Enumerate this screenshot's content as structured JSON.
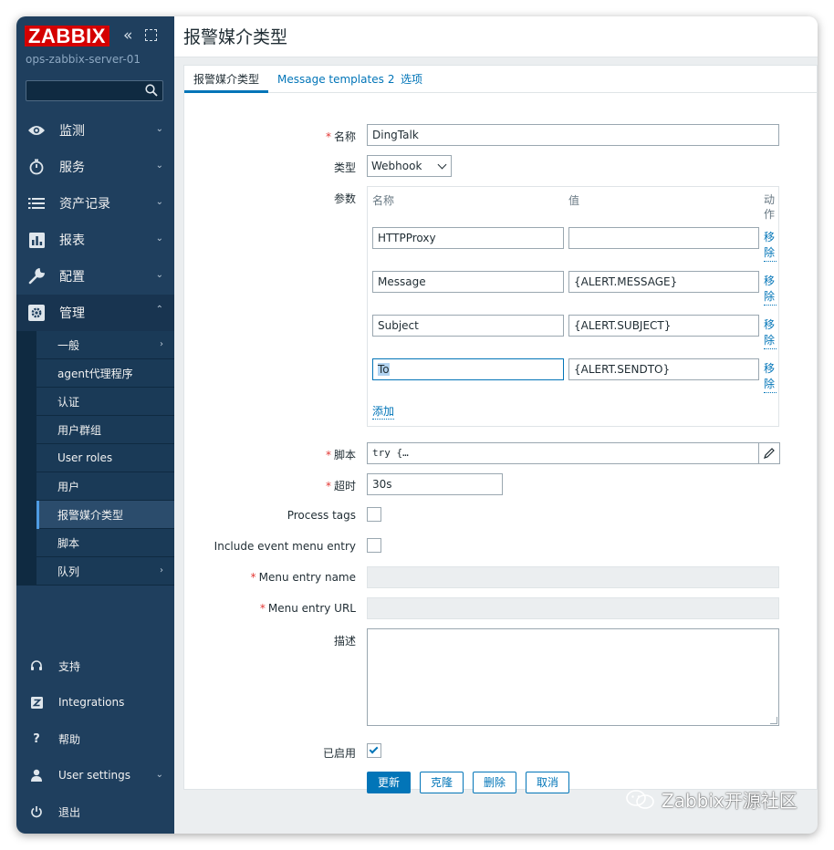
{
  "sidebar": {
    "logo": "ZABBIX",
    "collapse_glyph": "«",
    "server_name": "ops-zabbix-server-01",
    "search_placeholder": "",
    "menu": [
      {
        "label": "监测",
        "icon": "eye-icon"
      },
      {
        "label": "服务",
        "icon": "stopwatch-icon"
      },
      {
        "label": "资产记录",
        "icon": "list-icon"
      },
      {
        "label": "报表",
        "icon": "bar-chart-icon"
      },
      {
        "label": "配置",
        "icon": "wrench-icon"
      },
      {
        "label": "管理",
        "icon": "gear-icon"
      }
    ],
    "submenu": [
      {
        "label": "一般"
      },
      {
        "label": "agent代理程序"
      },
      {
        "label": "认证"
      },
      {
        "label": "用户群组"
      },
      {
        "label": "User roles"
      },
      {
        "label": "用户"
      },
      {
        "label": "报警媒介类型"
      },
      {
        "label": "脚本"
      },
      {
        "label": "队列"
      }
    ],
    "bottom": [
      {
        "label": "支持",
        "icon": "headset-icon"
      },
      {
        "label": "Integrations",
        "icon": "integrations-icon"
      },
      {
        "label": "帮助",
        "icon": "help-icon"
      },
      {
        "label": "User settings",
        "icon": "user-icon"
      },
      {
        "label": "退出",
        "icon": "power-icon"
      }
    ]
  },
  "header": {
    "title": "报警媒介类型"
  },
  "tabs": [
    {
      "label": "报警媒介类型"
    },
    {
      "label": "Message templates",
      "count": "2"
    },
    {
      "label": "选项"
    }
  ],
  "form": {
    "name_label": "名称",
    "name_value": "DingTalk",
    "type_label": "类型",
    "type_value": "Webhook",
    "params_label": "参数",
    "params_headers": {
      "name": "名称",
      "value": "值",
      "action": "动作"
    },
    "params": [
      {
        "name": "HTTPProxy",
        "value": "",
        "remove": "移除"
      },
      {
        "name": "Message",
        "value": "{ALERT.MESSAGE}",
        "remove": "移除"
      },
      {
        "name": "Subject",
        "value": "{ALERT.SUBJECT}",
        "remove": "移除"
      },
      {
        "name": "To",
        "value": "{ALERT.SENDTO}",
        "remove": "移除"
      }
    ],
    "add_label": "添加",
    "script_label": "脚本",
    "script_value": "try {…",
    "timeout_label": "超时",
    "timeout_value": "30s",
    "process_tags_label": "Process tags",
    "include_menu_label": "Include event menu entry",
    "menu_name_label": "Menu entry name",
    "menu_url_label": "Menu entry URL",
    "desc_label": "描述",
    "enabled_label": "已启用",
    "process_tags_checked": false,
    "include_menu_checked": false,
    "enabled_checked": true
  },
  "buttons": {
    "update": "更新",
    "clone": "克隆",
    "delete": "删除",
    "cancel": "取消"
  },
  "watermark": "Zabbix开源社区",
  "colors": {
    "accent": "#0275b8",
    "sidebar": "#1f3f5e",
    "logo": "#d40000",
    "required": "#e33734"
  }
}
